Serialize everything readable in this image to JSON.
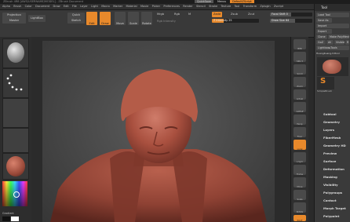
{
  "app": {
    "title": "ZBrush 4R8 [AWS/USERNAME/MODEL] - ZBrush Document",
    "window_buttons": [
      "QuickSave",
      "Menus",
      "DefaultZScript"
    ]
  },
  "menu": [
    "Alpha",
    "Brush",
    "Color",
    "Document",
    "Draw",
    "Edit",
    "File",
    "Layer",
    "Light",
    "Macro",
    "Marker",
    "Material",
    "Movie",
    "Picker",
    "Preferences",
    "Render",
    "Stencil",
    "Stroke",
    "Texture",
    "Tool",
    "Transform",
    "Zplugin",
    "Zscript"
  ],
  "toolbar": {
    "projection_master": "Projection Master",
    "lightbox": "LightBox",
    "quick_sketch": "Quick Sketch",
    "edit": "Edit",
    "draw": "Draw",
    "move": "Move",
    "scale": "Scale",
    "rotate": "Rotate",
    "mrgb": "Mrgb",
    "rgb": "Rgb",
    "m": "M",
    "rgb_intensity": "Rgb Intensity",
    "zadd": "Zadd",
    "zsub": "Zsub",
    "zcut": "Zcut",
    "focal_shift_label": "Focal Shift",
    "focal_shift_value": "0",
    "draw_size_label": "Draw Size",
    "draw_size_value": "64",
    "z_intensity_label": "Z Intensity",
    "z_intensity_value": "25",
    "z_intensity_level": 0.25,
    "focal_level": 0.5,
    "draw_size_level": 0.6
  },
  "left_shelf": {
    "gradient_label": "Gradient",
    "accent": "#e8892b"
  },
  "right_shelf": {
    "buttons": [
      "BPR",
      "SPix 3",
      "Scroll",
      "Zoom",
      "Actual",
      "AAHalf",
      "Persp",
      "Floor",
      "Local",
      "L.Sym",
      "Frame",
      "Move",
      "Scale",
      "Rotate",
      "PolyF",
      "Transp"
    ]
  },
  "tool_tray": {
    "title": "Tool",
    "load_tool": "Load Tool",
    "save_as": "Save As",
    "import": "Import",
    "export": "Export",
    "clone": "Clone",
    "make_polymesh": "Make PolyMesh3D",
    "goz": "GoZ",
    "all": "All",
    "visible": "Visible",
    "r": "R",
    "lightbox_tools": "Lightbox▸Tools",
    "current_tool": "HuangKuang-hdtool",
    "simple_brush": "SimpleBrush",
    "sections": [
      "Subtool",
      "Geometry",
      "Layers",
      "FiberMesh",
      "Geometry HD",
      "Preview",
      "Surface",
      "Deformation",
      "Masking",
      "Visibility",
      "Polygroups",
      "Contact",
      "Morph Target",
      "Polypaint"
    ]
  }
}
